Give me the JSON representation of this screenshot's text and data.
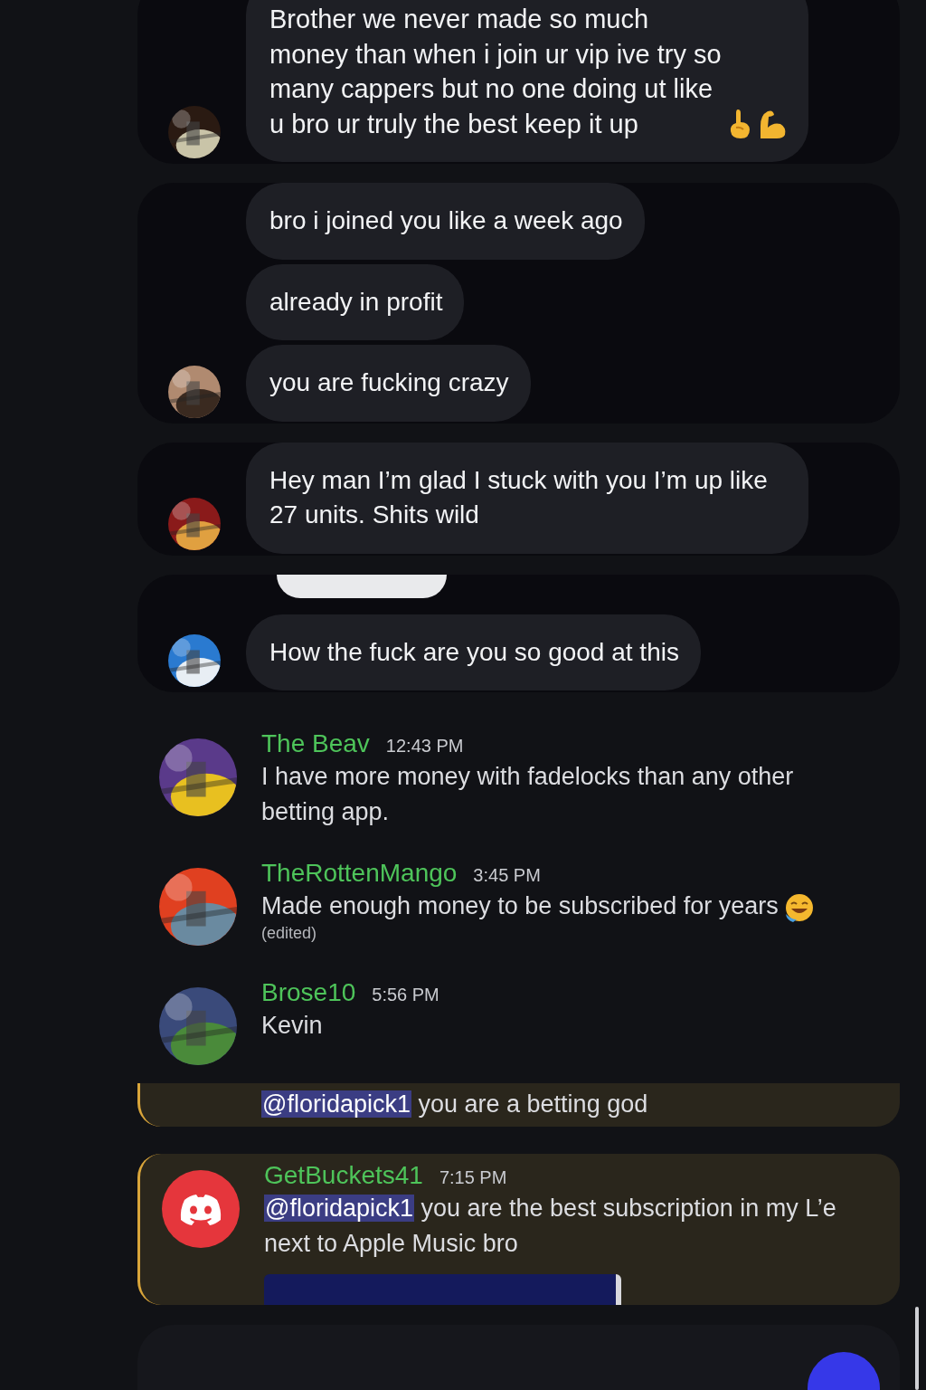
{
  "bubble_groups": [
    {
      "clipped_bubble": false,
      "avatar": {
        "kind": "picture"
      },
      "messages": [
        {
          "kind": "hands",
          "text": "Brother we never made so much money than when i join ur vip ive try so many cappers but no one doing ut like u bro ur truly the best keep it up"
        }
      ]
    },
    {
      "clipped_bubble": false,
      "avatar": {
        "kind": "picture"
      },
      "messages": [
        {
          "kind": "plain",
          "text": "bro i joined you like a week ago"
        },
        {
          "kind": "plain",
          "text": "already in profit"
        },
        {
          "kind": "plain",
          "text": "you are fucking crazy"
        }
      ]
    },
    {
      "clipped_bubble": false,
      "avatar": {
        "kind": "picture"
      },
      "messages": [
        {
          "kind": "plain",
          "text": "Hey man I’m glad I stuck with you I’m up like 27 units. Shits wild"
        }
      ]
    },
    {
      "clipped_bubble": true,
      "avatar": {
        "kind": "picture"
      },
      "messages": [
        {
          "kind": "plain",
          "text": "How the fuck are you so good at this"
        }
      ]
    }
  ],
  "chat_messages": [
    {
      "author": "The Beav",
      "time": "12:43 PM",
      "avatar": {
        "kind": "picture"
      },
      "highlighted": false,
      "embed": false,
      "paragraphs": [
        {
          "kind": "plain",
          "text": "I have more money with fadelocks than any other betting app.",
          "highlighted": false
        }
      ]
    },
    {
      "author": "TheRottenMango",
      "time": "3:45 PM",
      "avatar": {
        "kind": "picture"
      },
      "highlighted": false,
      "embed": false,
      "edited": "(edited)",
      "paragraphs": [
        {
          "kind": "laughing",
          "text": "Made enough money to be subscribed for years",
          "highlighted": false
        }
      ]
    },
    {
      "author": "Brose10",
      "time": "5:56 PM",
      "avatar": {
        "kind": "picture"
      },
      "highlighted": false,
      "embed": false,
      "paragraphs": [
        {
          "kind": "plain",
          "text": "Kevin",
          "highlighted": false
        },
        {
          "kind": "plain",
          "mention": "@floridapick1",
          "text": "you are a betting god",
          "highlighted": true
        }
      ]
    },
    {
      "author": "GetBuckets41",
      "time": "7:15 PM",
      "avatar": {
        "kind": "logo",
        "color": "#e5363c"
      },
      "highlighted": true,
      "embed": true,
      "paragraphs": [
        {
          "kind": "plain",
          "mention": "@floridapick1",
          "text": "you are the best subscription in my L’e next to Apple Music bro",
          "highlighted": false
        }
      ]
    }
  ]
}
